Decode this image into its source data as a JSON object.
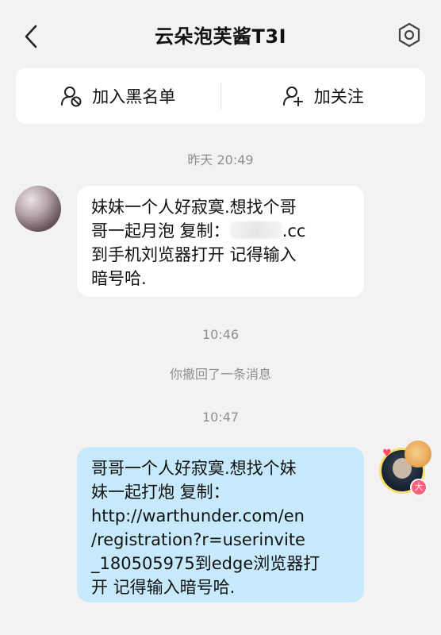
{
  "header": {
    "title": "云朵泡芙酱T3I",
    "icons": {
      "back": "chevron-left-icon",
      "settings": "settings-hex-icon"
    }
  },
  "actions": [
    {
      "label": "加入黑名单",
      "icon": "block-user-icon"
    },
    {
      "label": "加关注",
      "icon": "add-user-icon"
    }
  ],
  "messages": {
    "ts1": "昨天 20:49",
    "incoming_line1": "妹妹一个人好寂寞.想找个哥",
    "incoming_line2_a": "哥一起月泡 复制：",
    "incoming_line2_b": ".cc",
    "incoming_line3": "到手机刘览器打开 记得输入",
    "incoming_line4": "暗号哈.",
    "ts2": "10:46",
    "recall_notice": "你撤回了一条消息",
    "ts3": "10:47",
    "outgoing_line1": "哥哥一个人好寂寞.想找个妹",
    "outgoing_line2": "妹一起打炮 复制：",
    "outgoing_line3": "http://warthunder.com/en",
    "outgoing_line4": "/registration?r=userinvite",
    "outgoing_line5": "_180505975到edge浏览器打",
    "outgoing_line6": "开 记得输入暗号哈."
  },
  "badges": {
    "avatar_level": "大"
  },
  "colors": {
    "background": "#f2f2f2",
    "incoming_bubble": "#ffffff",
    "outgoing_bubble": "#c6eafb",
    "timestamp": "#8f8f8f"
  }
}
